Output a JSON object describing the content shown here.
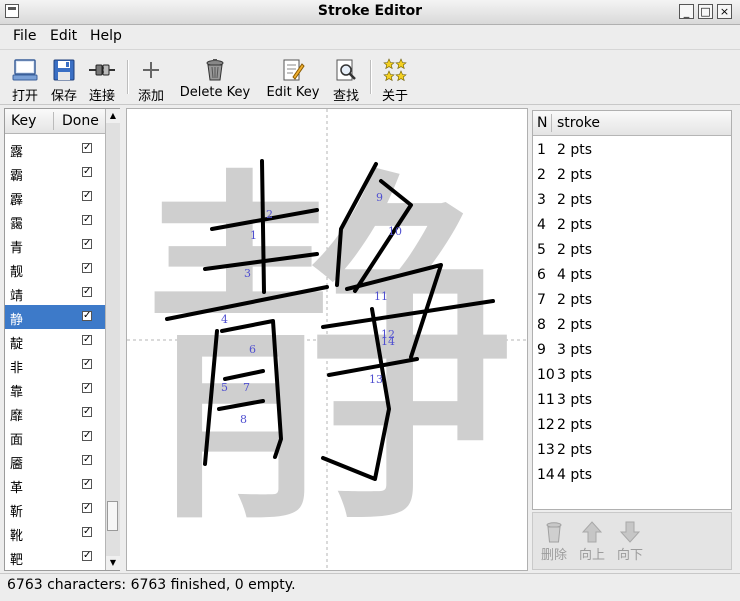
{
  "window": {
    "title": "Stroke Editor",
    "minimize_glyph": "_",
    "maximize_glyph": "□",
    "close_glyph": "×"
  },
  "menu": {
    "file": "File",
    "edit": "Edit",
    "help": "Help"
  },
  "toolbar": {
    "open": "打开",
    "save": "保存",
    "connect": "连接",
    "add": "添加",
    "delete_key": "Delete Key",
    "edit_key": "Edit Key",
    "find": "查找",
    "about": "关于"
  },
  "key_list": {
    "col_key": "Key",
    "col_done": "Done",
    "rows": [
      {
        "key": "露",
        "done": "✓"
      },
      {
        "key": "霸",
        "done": "✓"
      },
      {
        "key": "霹",
        "done": "✓"
      },
      {
        "key": "靄",
        "done": "✓"
      },
      {
        "key": "青",
        "done": "✓"
      },
      {
        "key": "靓",
        "done": "✓"
      },
      {
        "key": "靖",
        "done": "✓"
      },
      {
        "key": "静",
        "done": "✓"
      },
      {
        "key": "靛",
        "done": "✓"
      },
      {
        "key": "非",
        "done": "✓"
      },
      {
        "key": "靠",
        "done": "✓"
      },
      {
        "key": "靡",
        "done": "✓"
      },
      {
        "key": "面",
        "done": "✓"
      },
      {
        "key": "靥",
        "done": "✓"
      },
      {
        "key": "革",
        "done": "✓"
      },
      {
        "key": "靳",
        "done": "✓"
      },
      {
        "key": "靴",
        "done": "✓"
      },
      {
        "key": "靶",
        "done": "✓"
      }
    ],
    "selected_index": 7
  },
  "canvas": {
    "character": "静",
    "stroke_labels": [
      "1",
      "2",
      "3",
      "4",
      "5",
      "6",
      "7",
      "8",
      "9",
      "10",
      "11",
      "12",
      "13",
      "14"
    ]
  },
  "stroke_list": {
    "col_n": "N",
    "col_stroke": "stroke",
    "rows": [
      {
        "n": "1",
        "pts": "2 pts"
      },
      {
        "n": "2",
        "pts": "2 pts"
      },
      {
        "n": "3",
        "pts": "2 pts"
      },
      {
        "n": "4",
        "pts": "2 pts"
      },
      {
        "n": "5",
        "pts": "2 pts"
      },
      {
        "n": "6",
        "pts": "4 pts"
      },
      {
        "n": "7",
        "pts": "2 pts"
      },
      {
        "n": "8",
        "pts": "2 pts"
      },
      {
        "n": "9",
        "pts": "3 pts"
      },
      {
        "n": "10",
        "pts": "3 pts"
      },
      {
        "n": "11",
        "pts": "3 pts"
      },
      {
        "n": "12",
        "pts": "2 pts"
      },
      {
        "n": "13",
        "pts": "2 pts"
      },
      {
        "n": "14",
        "pts": "4 pts"
      }
    ]
  },
  "stroke_tools": {
    "delete": "删除",
    "up": "向上",
    "down": "向下"
  },
  "status": {
    "text": "6763 characters: 6763 finished, 0 empty."
  },
  "icons": {
    "open": "computer-icon",
    "save": "floppy-disk-icon",
    "connect": "plug-icon",
    "add": "plus-icon",
    "delete_key": "trash-can-icon",
    "edit_key": "edit-document-icon",
    "find": "magnifier-document-icon",
    "about": "stars-icon"
  },
  "colors": {
    "selection": "#3d7ac9",
    "stroke_label": "#5050d0",
    "disabled": "#9c9c9c"
  }
}
